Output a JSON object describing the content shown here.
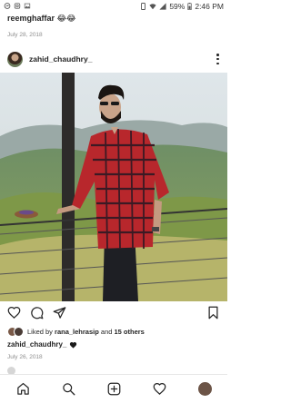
{
  "status_bar": {
    "battery": "59%",
    "time": "2:46 PM"
  },
  "previous_post": {
    "caption": "reemghaffar 😂😂",
    "date": "July 28, 2018"
  },
  "post": {
    "username": "zahid_chaudhry_",
    "likes_text_prefix": "Liked by ",
    "likes_user": "rana_lehrasip",
    "likes_text_middle": " and ",
    "likes_others": "15 others",
    "caption_user": "zahid_chaudhry_",
    "date": "July 26, 2018"
  },
  "colors": {
    "text": "#262626",
    "muted": "#8e8e8e",
    "accent": "#ed4956"
  },
  "icons": {
    "actions": [
      "heart-icon",
      "comment-icon",
      "share-icon",
      "bookmark-icon"
    ],
    "nav": [
      "home-icon",
      "search-icon",
      "add-post-icon",
      "activity-heart-icon",
      "profile-avatar"
    ]
  }
}
